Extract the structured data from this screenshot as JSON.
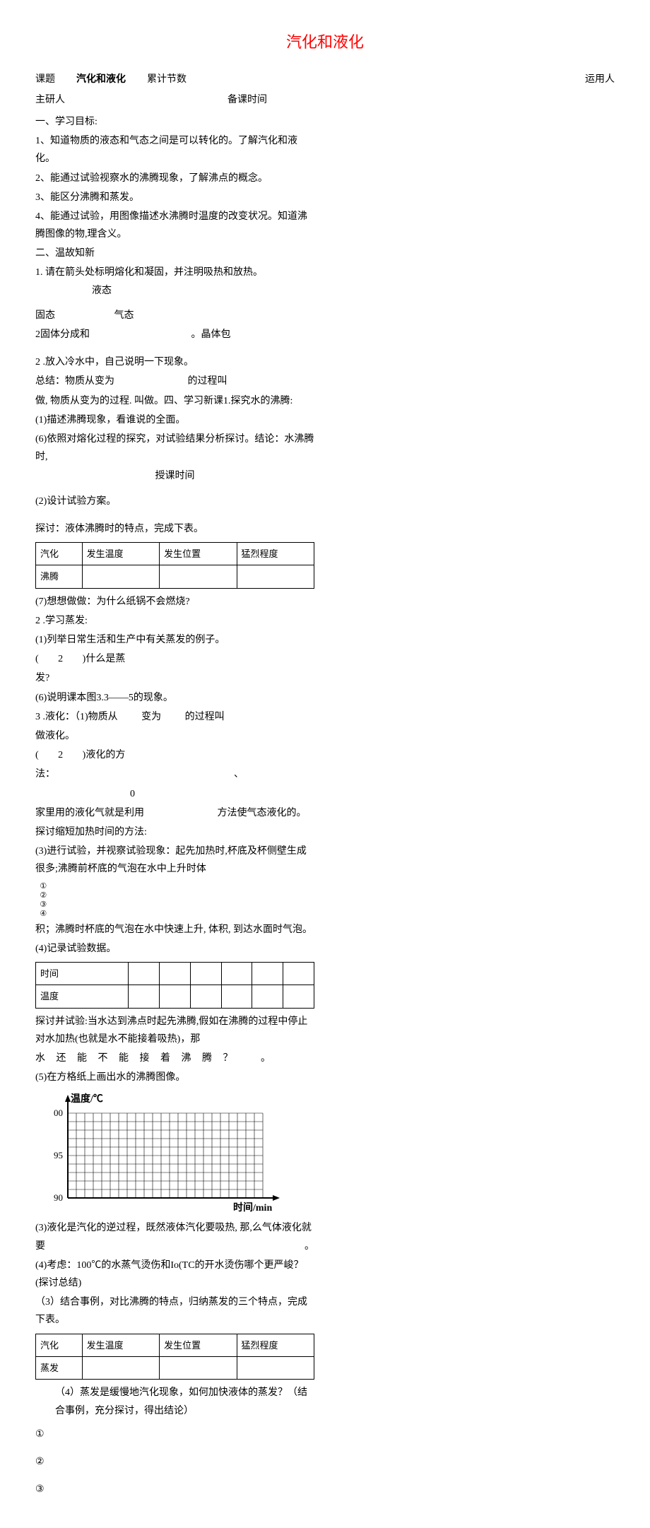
{
  "title": "汽化和液化",
  "header": {
    "topic_label": "课题",
    "topic_value": "汽化和液化",
    "lesson_count_label": "累计节数",
    "user_label": "运用人",
    "main_researcher_label": "主研人",
    "prep_time_label": "备课时间",
    "teach_time_label": "授课时间"
  },
  "sec1": {
    "h": "一、学习目标:",
    "g1": "1、知道物质的液态和气态之间是可以转化的。了解汽化和液化。",
    "g2": "2、能通过试验视察水的沸腾现象，了解沸点的概念。",
    "g3": "3、能区分沸腾和蒸发。",
    "g4": "4、能通过试验，用图像描述水沸腾时温度的改变状况。知道沸腾图像的物,理含义。"
  },
  "sec2": {
    "h": "二、温故知新",
    "l1": "1. 请在箭头处标明熔化和凝固，并注明吸热和放热。",
    "state_liquid": "液态",
    "state_solid": "固态",
    "state_gas": "气态",
    "l2a": "2固体分成和",
    "l2b": "。晶体包"
  },
  "sec3": {
    "l3": "2 .放入冷水中，自己说明一下现象。",
    "summary_a": "总结：物质从变为",
    "summary_b": "的过程叫",
    "summary_c": "做,  物质从变为的过程. 叫做。四、学习新课1.探究水的沸腾:",
    "p1": "(1)描述沸腾现象，看谁说的全面。",
    "p6": "(6)依照对熔化过程的探究，对试验结果分析探讨。结论：水沸腾时,",
    "p2": "(2)设计试验方案。"
  },
  "discuss1": "探讨：液体沸腾时的特点，完成下表。",
  "table1": {
    "c0": "汽化",
    "c1": "发生温度",
    "c2": "发生位置",
    "c3": "猛烈程度",
    "r1": "沸腾"
  },
  "sec4": {
    "p7": "(7)想想做做：为什么纸锅不会燃烧?",
    "p_2a": "2 .学习蒸发:",
    "p_1": "(1)列举日常生活和生产中有关蒸发的例子。",
    "p_2b_a": "(",
    "p_2b_b": "2",
    "p_2b_c": ")什么是蒸",
    "p_2b_d": "发?",
    "p_6": "(6)说明课本图3.3——5的现象。",
    "p_3a": "3 .液化：（1)物质从",
    "p_3b": "变为",
    "p_3c": "的过程叫",
    "p_3d": "做液化。",
    "p_2c_a": "(",
    "p_2c_b": "2",
    "p_2c_c": ")液化的方",
    "p_2c_d": "法：",
    "sym1": "、",
    "sym2": "0",
    "home_a": "家里用的液化气就是利用",
    "home_b": "方法使气态液化的。"
  },
  "sec5": {
    "discuss_method": "探讨缩短加热时间的方法:",
    "p3": "(3)进行试验，并视察试验现象：起先加热时,杯底及杯侧壁生成很多;沸腾前杯底的气泡在水中上升时体",
    "vert": "①②③④",
    "p3b": "积；沸腾时杯底的气泡在水中快速上升,  体积,  到达水面时气泡。",
    "p4": "(4)记录试验数据。"
  },
  "table2": {
    "r0": "时间",
    "r1": "温度"
  },
  "sec6": {
    "discuss_boil_a": "探讨并试验:当水达到沸点时起先沸腾,假如在沸腾的过程中停止对水加热(也就是水不能接着吸热)，那",
    "discuss_boil_b": "水 还 能 不 能 接 着 沸 腾 ？",
    "discuss_boil_c": "。",
    "p5": "(5)在方格纸上画出水的沸腾图像。"
  },
  "chart_data": {
    "type": "line",
    "title": "",
    "ylabel": "温度/℃",
    "xlabel": "时间/min",
    "ylim": [
      90,
      100
    ],
    "yticks": [
      90,
      95,
      100
    ],
    "ytick_labels": [
      "90",
      "95",
      "00"
    ],
    "x_grid_count": 23,
    "y_grid_count": 10,
    "values": []
  },
  "sec7": {
    "p3_liq_a": "(3)液化是汽化的逆过程，既然液体汽化要吸热,  那,么气体液化就要",
    "p3_liq_b": "。",
    "p4_q": "(4)考虑：100℃的水蒸气烫伤和Io(TC的开水烫伤哪个更严峻？(探讨总结)",
    "p3_comp": "（3）结合事例，对比沸腾的特点，归纳蒸发的三个特点，完成下表。"
  },
  "table3": {
    "c0": "汽化",
    "c1": "发生温度",
    "c2": "发生位置",
    "c3": "猛烈程度",
    "r1": "蒸发"
  },
  "sec8": {
    "p4_speed": "（4）蒸发是缓慢地汽化现象，如何加快液体的蒸发？（结合事例，充分探讨，得出结论）",
    "b1": "①",
    "b2": "②",
    "b3": "③"
  }
}
